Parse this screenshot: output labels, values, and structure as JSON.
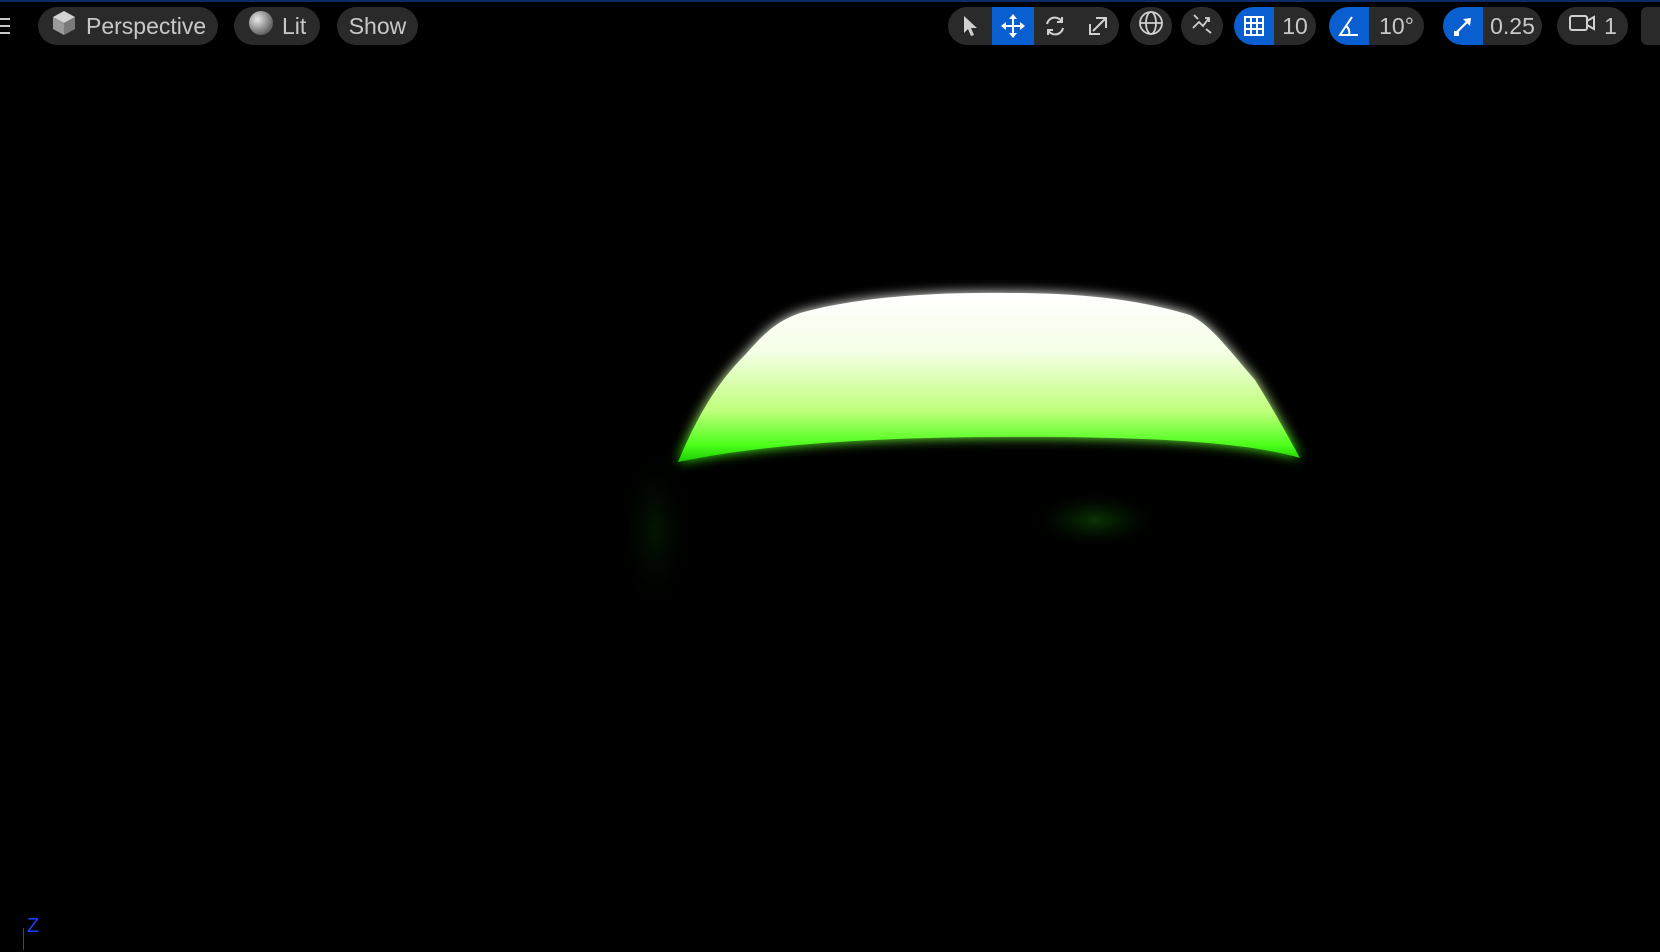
{
  "viewport": {
    "view_mode_label": "Perspective",
    "lighting_label": "Lit",
    "show_label": "Show",
    "axis_label": "Z"
  },
  "toolbar": {
    "grid_snap_value": "10",
    "rotation_snap_value": "10°",
    "scale_snap_value": "0.25",
    "camera_speed_value": "1"
  },
  "icons": {
    "menu": "hamburger-menu-icon",
    "view_mode": "cube-icon",
    "lighting": "sphere-icon",
    "select": "arrow-cursor-icon",
    "translate": "move-arrows-icon",
    "rotate": "rotate-icon",
    "scale": "scale-icon",
    "coordinate_space": "globe-icon",
    "surface_snapping": "surface-snap-icon",
    "grid_snap": "grid-icon",
    "rotation_snap": "angle-icon",
    "scale_snap": "scale-arrow-icon",
    "camera_speed": "camera-icon"
  },
  "colors": {
    "accent": "#0a5fd0",
    "glow_green": "#39ff14",
    "axis_blue": "#1a3cff"
  }
}
